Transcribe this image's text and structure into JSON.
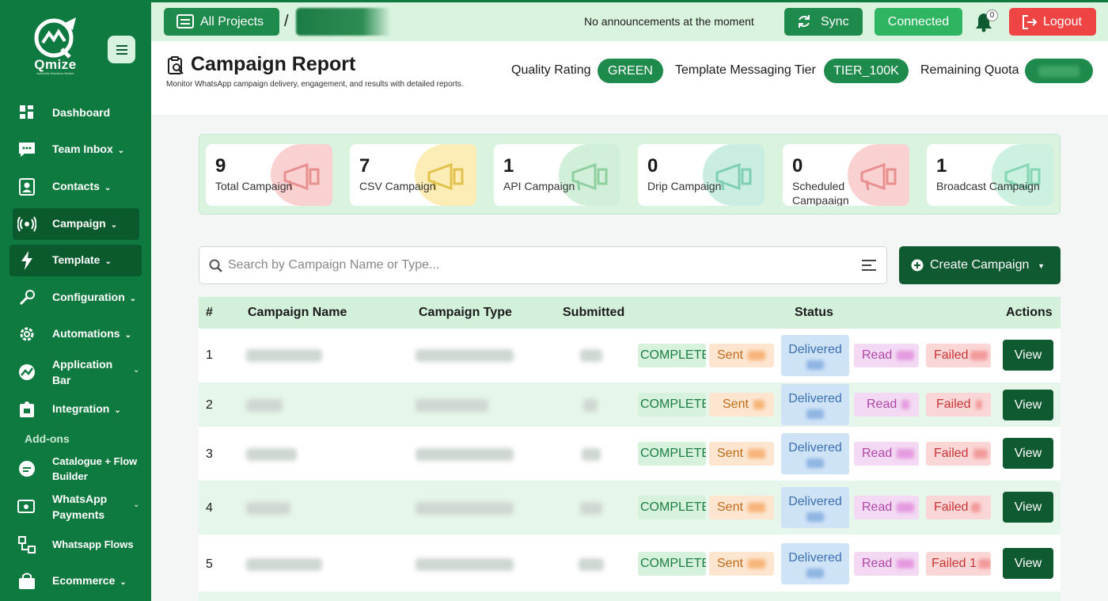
{
  "brand": {
    "name": "Qmize",
    "tagline": "Authentic Business Builder"
  },
  "sidebar": {
    "items": [
      {
        "label": "Dashboard",
        "has_chevron": false
      },
      {
        "label": "Team Inbox",
        "has_chevron": true
      },
      {
        "label": "Contacts",
        "has_chevron": true
      },
      {
        "label": "Campaign",
        "has_chevron": true
      },
      {
        "label": "Template",
        "has_chevron": true
      },
      {
        "label": "Configuration",
        "has_chevron": true
      },
      {
        "label": "Automations",
        "has_chevron": true
      },
      {
        "label": "Application Bar",
        "has_chevron": true
      },
      {
        "label": "Integration",
        "has_chevron": true
      }
    ],
    "addons_label": "Add-ons",
    "addons": [
      {
        "label": "Catalogue + Flow Builder",
        "has_chevron": false
      },
      {
        "label": "WhatsApp Payments",
        "has_chevron": true
      },
      {
        "label": "Whatsapp Flows",
        "has_chevron": false
      },
      {
        "label": "Ecommerce",
        "has_chevron": true
      }
    ]
  },
  "topbar": {
    "all_projects": "All Projects",
    "separator": "/",
    "announcement": "No announcements at the moment",
    "sync": "Sync",
    "connected": "Connected",
    "notifications_count": "0",
    "logout": "Logout"
  },
  "header": {
    "title": "Campaign Report",
    "subtitle": "Monitor WhatsApp campaign delivery, engagement, and results with detailed reports.",
    "quality_label": "Quality Rating",
    "quality_value": "GREEN",
    "tier_label": "Template Messaging Tier",
    "tier_value": "TIER_100K",
    "quota_label": "Remaining Quota"
  },
  "stats": [
    {
      "value": "9",
      "label": "Total Campaign",
      "color": "#f9c9c9"
    },
    {
      "value": "7",
      "label": "CSV Campaign",
      "color": "#fbe9a8"
    },
    {
      "value": "1",
      "label": "API Campaign",
      "color": "#c9ecd2"
    },
    {
      "value": "0",
      "label": "Drip Campaign",
      "color": "#bfeadb"
    },
    {
      "value": "0",
      "label": "Scheduled Campaaign",
      "color": "#f9c9c9"
    },
    {
      "value": "1",
      "label": "Broadcast Campaign",
      "color": "#c3eedb"
    }
  ],
  "search": {
    "placeholder": "Search by Campaign Name or Type..."
  },
  "create_campaign": "Create Campaign",
  "table": {
    "headers": {
      "num": "#",
      "name": "Campaign Name",
      "type": "Campaign Type",
      "submitted": "Submitted",
      "status": "Status",
      "actions": "Actions"
    },
    "rows": [
      {
        "num": "1",
        "status": "COMPLETED",
        "sent": "Sent",
        "delivered": "Delivered",
        "read": "Read",
        "failed": "Failed",
        "action": "View"
      },
      {
        "num": "2",
        "status": "COMPLETED",
        "sent": "Sent",
        "delivered": "Delivered",
        "read": "Read",
        "failed": "Failed",
        "action": "View"
      },
      {
        "num": "3",
        "status": "COMPLETED",
        "sent": "Sent",
        "delivered": "Delivered",
        "read": "Read",
        "failed": "Failed",
        "action": "View"
      },
      {
        "num": "4",
        "status": "COMPLETED",
        "sent": "Sent",
        "delivered": "Delivered",
        "read": "Read",
        "failed": "Failed",
        "action": "View"
      },
      {
        "num": "5",
        "status": "COMPLETED",
        "sent": "Sent",
        "delivered": "Delivered",
        "read": "Read",
        "failed": "Failed 1",
        "action": "View"
      }
    ]
  },
  "colors": {
    "primary": "#0f7a3f",
    "accent": "#1e8a4c",
    "danger": "#ef4444",
    "light": "#d9f3df"
  }
}
